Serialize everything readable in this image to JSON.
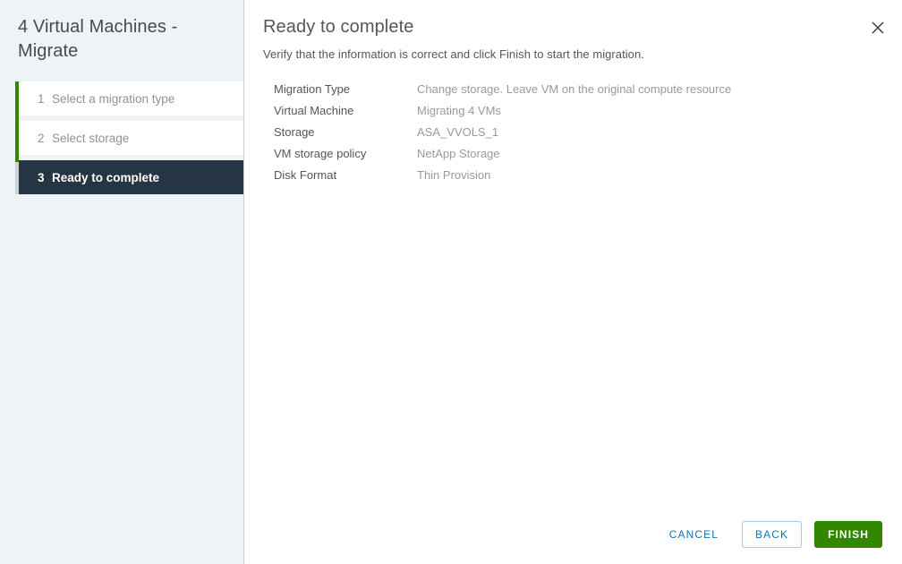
{
  "sidebar": {
    "title": "4 Virtual Machines - Migrate",
    "steps": [
      {
        "num": "1",
        "label": "Select a migration type",
        "state": "inactive"
      },
      {
        "num": "2",
        "label": "Select storage",
        "state": "inactive"
      },
      {
        "num": "3",
        "label": "Ready to complete",
        "state": "active"
      }
    ]
  },
  "main": {
    "heading": "Ready to complete",
    "subtitle": "Verify that the information is correct and click Finish to start the migration.",
    "summary": [
      {
        "label": "Migration Type",
        "value": "Change storage. Leave VM on the original compute resource"
      },
      {
        "label": "Virtual Machine",
        "value": "Migrating 4 VMs"
      },
      {
        "label": "Storage",
        "value": "ASA_VVOLS_1"
      },
      {
        "label": "VM storage policy",
        "value": "NetApp Storage"
      },
      {
        "label": "Disk Format",
        "value": "Thin Provision"
      }
    ]
  },
  "footer": {
    "cancel_label": "CANCEL",
    "back_label": "BACK",
    "finish_label": "FINISH"
  },
  "icons": {
    "close": "close-icon"
  },
  "colors": {
    "accent_green": "#318700",
    "link_blue": "#0079b8",
    "active_step_bg": "#263543",
    "sidebar_bg": "#eef3f6"
  }
}
